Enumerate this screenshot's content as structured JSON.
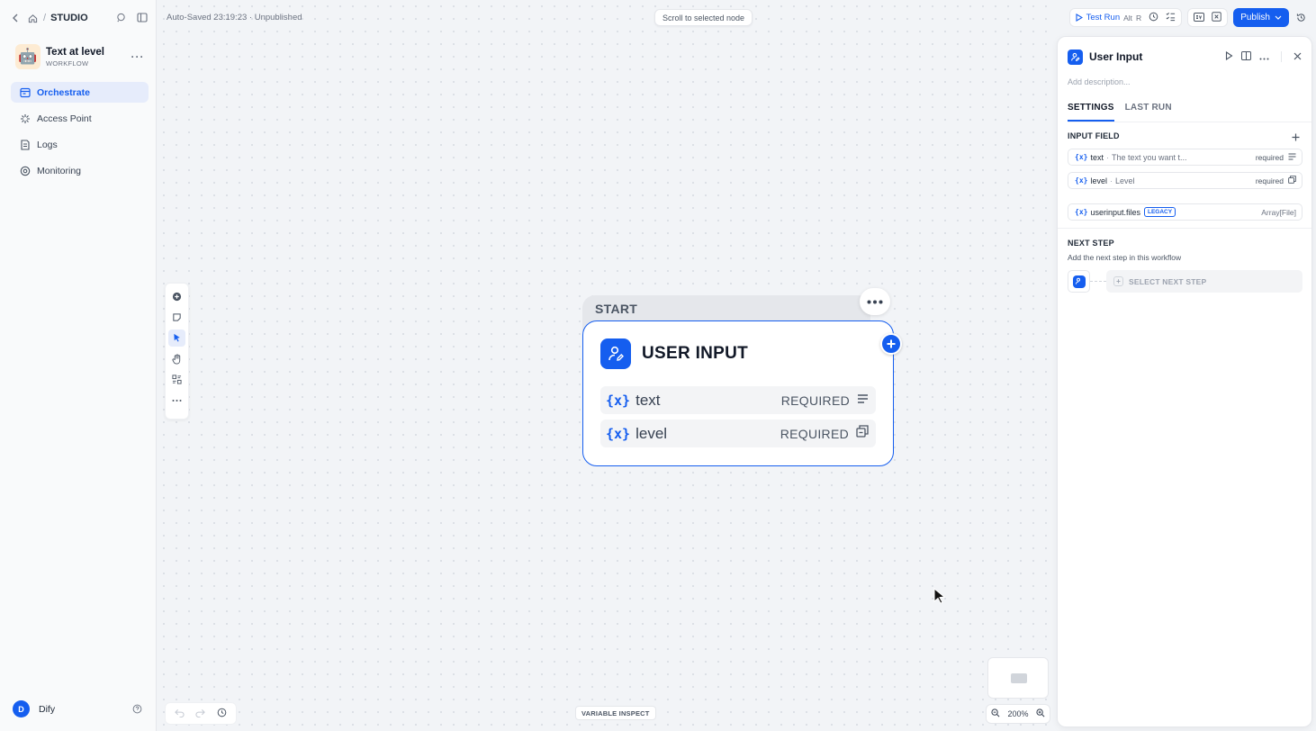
{
  "breadcrumb": {
    "separator": "/",
    "studio": "STUDIO"
  },
  "app": {
    "name": "Text at level",
    "kind": "WORKFLOW",
    "avatar": "🤖"
  },
  "nav": [
    {
      "label": "Orchestrate",
      "icon": "orchestrate-icon",
      "active": true
    },
    {
      "label": "Access Point",
      "icon": "access-point-icon",
      "active": false
    },
    {
      "label": "Logs",
      "icon": "logs-icon",
      "active": false
    },
    {
      "label": "Monitoring",
      "icon": "monitoring-icon",
      "active": false
    }
  ],
  "user": {
    "initial": "D",
    "name": "Dify"
  },
  "canvas": {
    "autosave": "Auto-Saved 23:19:23 · Unpublished",
    "scroll_pill": "Scroll to selected node",
    "variable_inspect": "VARIABLE INSPECT",
    "zoom": "200%"
  },
  "node": {
    "tab_label": "START",
    "title": "USER INPUT",
    "vars": [
      {
        "name": "text",
        "required": "REQUIRED",
        "icon": "paragraph-icon"
      },
      {
        "name": "level",
        "required": "REQUIRED",
        "icon": "select-icon"
      }
    ]
  },
  "header": {
    "test_run": "Test Run",
    "shortcut_alt": "Alt",
    "shortcut_key": "R",
    "publish": "Publish"
  },
  "panel": {
    "title": "User Input",
    "description_placeholder": "Add description...",
    "tabs": [
      "SETTINGS",
      "LAST RUN"
    ],
    "input_field_title": "INPUT FIELD",
    "fields": [
      {
        "name": "text",
        "label": "The text you want t...",
        "required": "required"
      },
      {
        "name": "level",
        "label": "Level",
        "required": "required"
      }
    ],
    "system_field": {
      "name": "userinput.files",
      "badge": "LEGACY",
      "type": "Array[File]"
    },
    "next_step_title": "NEXT STEP",
    "next_step_sub": "Add the next step in this workflow",
    "select_next": "SELECT NEXT STEP"
  },
  "colors": {
    "accent": "#155eef",
    "canvas_bg": "#f2f4f7"
  }
}
